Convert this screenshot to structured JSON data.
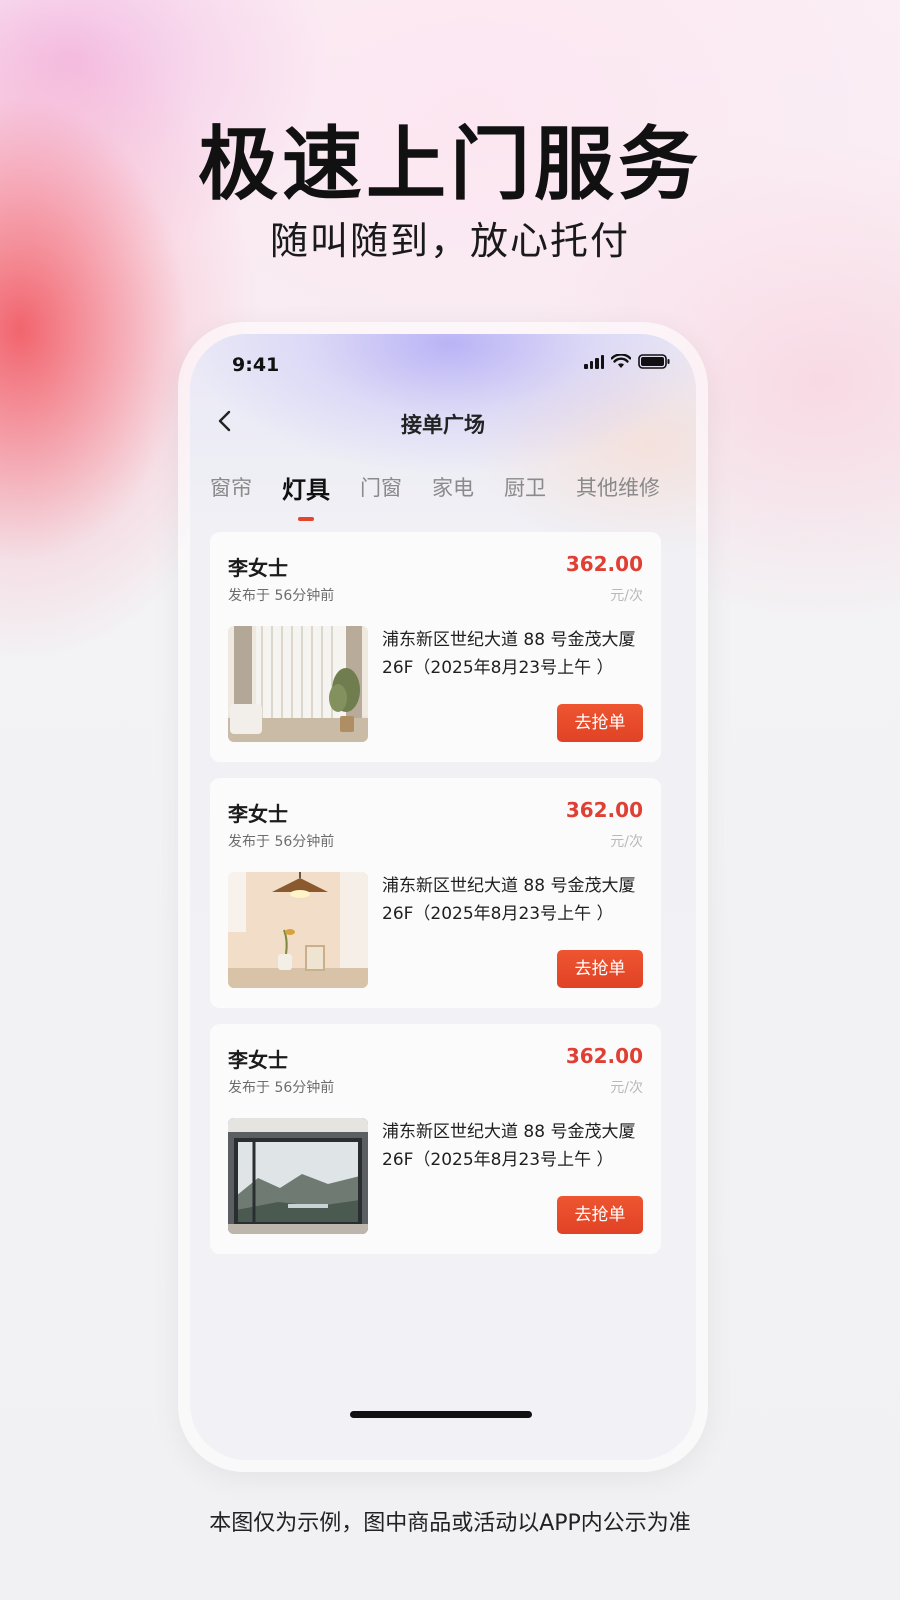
{
  "headline": "极速上门服务",
  "subline": "随叫随到，放心托付",
  "status_bar": {
    "time": "9:41"
  },
  "nav": {
    "title": "接单广场"
  },
  "tabs": [
    {
      "label": "窗帘"
    },
    {
      "label": "灯具",
      "active": true
    },
    {
      "label": "门窗"
    },
    {
      "label": "家电"
    },
    {
      "label": "厨卫"
    },
    {
      "label": "其他维修"
    }
  ],
  "orders": [
    {
      "name": "李女士",
      "posted": "发布于 56分钟前",
      "price": "362.00",
      "unit": "元/次",
      "address": "浦东新区世纪大道 88 号金茂大厦 26F（2025年8月23号上午 ）",
      "button": "去抢单",
      "image": "curtain-room-photo"
    },
    {
      "name": "李女士",
      "posted": "发布于 56分钟前",
      "price": "362.00",
      "unit": "元/次",
      "address": "浦东新区世纪大道 88 号金茂大厦 26F（2025年8月23号上午 ）",
      "button": "去抢单",
      "image": "pendant-lamp-photo"
    },
    {
      "name": "李女士",
      "posted": "发布于 56分钟前",
      "price": "362.00",
      "unit": "元/次",
      "address": "浦东新区世纪大道 88 号金茂大厦 26F（2025年8月23号上午 ）",
      "button": "去抢单",
      "image": "window-view-photo"
    }
  ],
  "disclaimer": "本图仅为示例，图中商品或活动以APP内公示为准",
  "colors": {
    "accent": "#e5452d",
    "price": "#e04034"
  }
}
